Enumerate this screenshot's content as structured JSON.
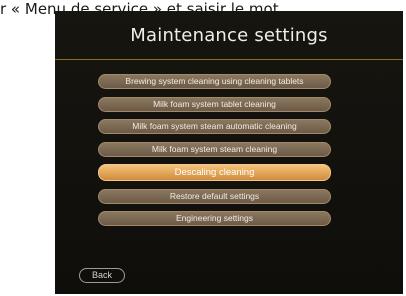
{
  "document": {
    "caption_text": "r « Menu de service » et saisir le mot"
  },
  "screen": {
    "title": "Maintenance settings",
    "menu": [
      {
        "label": "Brewing system cleaning using cleaning tablets",
        "active": false
      },
      {
        "label": "Milk foam system tablet cleaning",
        "active": false
      },
      {
        "label": "Milk foam system steam automatic cleaning",
        "active": false
      },
      {
        "label": "Milk foam system steam cleaning",
        "active": false
      },
      {
        "label": "Descaling cleaning",
        "active": true
      },
      {
        "label": "Restore default settings",
        "active": false
      },
      {
        "label": "Engineering settings",
        "active": false
      }
    ],
    "back_label": "Back"
  },
  "colors": {
    "screen_bg": "#15130f",
    "button": "#7b6853",
    "active_button": "#e3a55a",
    "divider": "#8c6a2a"
  }
}
